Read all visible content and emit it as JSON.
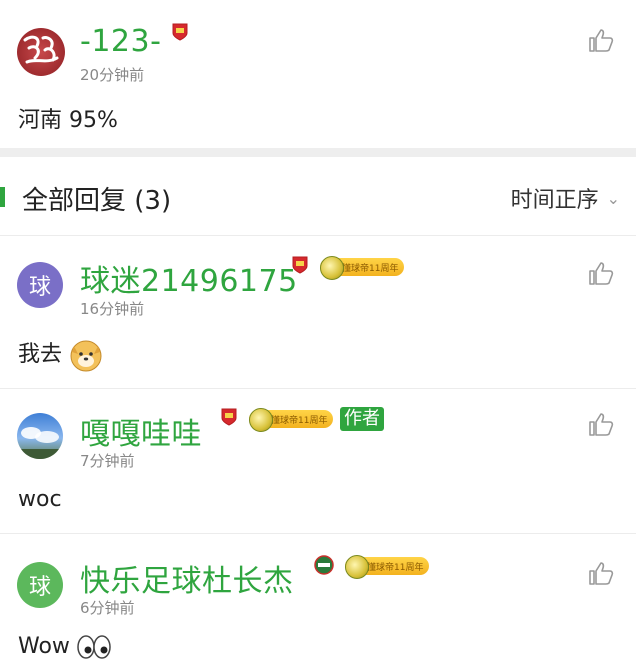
{
  "post": {
    "username": "-123-",
    "time": "20分钟前",
    "content": "河南 95%"
  },
  "replies_header": {
    "title": "全部回复 (3)",
    "sort_label": "时间正序"
  },
  "replies": [
    {
      "avatar_text": "球",
      "avatar_color": "#7a6fc7",
      "username": "球迷21496175",
      "time": "16分钟前",
      "content": "我去",
      "badge_text": "懂球帝11周年"
    },
    {
      "username": "嘎嘎哇哇",
      "time": "7分钟前",
      "content": "woc",
      "badge_text": "懂球帝11周年",
      "author_tag": "作者"
    },
    {
      "avatar_text": "球",
      "avatar_color": "#5cb85c",
      "username": "快乐足球杜长杰",
      "time": "6分钟前",
      "content": "Wow",
      "badge_text": "懂球帝11周年"
    }
  ],
  "colors": {
    "accent_green": "#2fa53f",
    "badge_gold": "#f3b21f"
  },
  "icons": [
    "thumbs-up-icon",
    "chevron-down-icon",
    "team-shield-icon",
    "anniversary-badge-icon"
  ]
}
